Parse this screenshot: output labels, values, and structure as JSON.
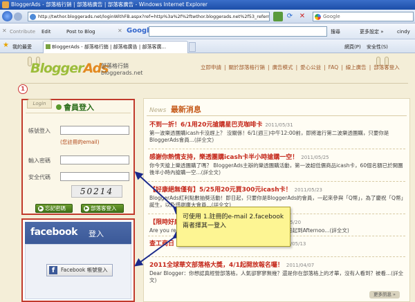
{
  "window": {
    "title": "BloggerAds - 部落格行銷 | 部落格廣告 | 部落客廣告 - Windows Internet Explorer",
    "url": "http://twthor.bloggerads.net/loginWithFB.aspx?ref=http%3a%2f%2ftwthor.bloggerads.net%2f53_referral_cod",
    "google_search_placeholder": "Google"
  },
  "toolbar": {
    "contribute": "Contribute",
    "edit": "Edit",
    "post_to_blog": "Post to Blog",
    "google": "Google",
    "search": "搜尋",
    "settings": "更多設定 »",
    "user": "cindy"
  },
  "favbar": {
    "favorites": "我的最愛",
    "tab_title": "BloggerAds - 部落格行銷 | 部落格廣告 | 部落客廣...",
    "page_menu": "網頁(P)",
    "safety_menu": "安全性(S)"
  },
  "site": {
    "logo_main": "Blogger",
    "logo_accent": "Ads",
    "logo_sub_cn": "部落格行銷",
    "logo_sub_en": "bloggerads.net",
    "nav": [
      "立即申請",
      "關於部落格行銷",
      "廣告模式",
      "愛心公益",
      "FAQ",
      "線上廣告",
      "部落客登入"
    ],
    "nav_sep": "|"
  },
  "step_badge": "1",
  "login": {
    "tab_label": "Login",
    "title": "會員登入",
    "account_label": "帳號登入",
    "account_hint": "(您註冊的email)",
    "password_label": "輸入密碼",
    "captcha_label": "安全代碼",
    "captcha_value": "50214",
    "forgot_button": "忘記密碼",
    "register_button": "部落客登入"
  },
  "facebook": {
    "brand": "facebook",
    "login_word": "登入",
    "button_label": "Facebook 帳號登入",
    "icon_letter": "f"
  },
  "news": {
    "header_en": "News",
    "header_cn": "最新消息",
    "items": [
      {
        "title": "不到一折！6/1用20元搶購星巴克咖啡卡",
        "date": "2011/05/31",
        "desc": "第一波樂透團購icash卡沒趕上？ 沒關係！6/1(週三)中午12:00前，即將進行第二波樂透團購，只要你是BloggerAds會員...",
        "more": "(詳全文)"
      },
      {
        "title": "感謝你熱情支持，樂透團購icash卡半小時搶購一空！",
        "date": "2011/05/25",
        "desc": "你今天搶上樂透團購了嗎？ BloggerAds主辦的樂透團購活動，第一波超低價商品icash卡，60個名額已於開團後半小時內搶購一空...",
        "more": "(詳全文)"
      },
      {
        "title": "【好康絕無僅有】5/25用20元買300元icash卡！",
        "date": "2011/05/23",
        "desc": "BloggerAds紅利點數抽獎活動！即日起，只要你是BloggerAds的會員，一起來參與「Q幣」，為了慶祝「Q幣」誕生，以及感謝廣大會員...",
        "more": "(詳全文)"
      },
      {
        "title": "【限時好康】抽獎送7-ELEVEN「下午茶」",
        "date": "2011/05/20",
        "desc": "Are you ready? 即日起，只要你是BloggerAds的會員，即日起到Afternoo...",
        "more": "(詳全文)"
      },
      {
        "title": "查工商日",
        "date": "2011/05/13",
        "desc": "",
        "more": ""
      },
      {
        "title": "2011全球華文部落格大獎，4/1起開放報名囉！",
        "date": "2011/04/07",
        "desc": "Dear Blogger：你想認真經營部落格，人氣卻寥寥無幾？還是你在部落格上的才華，沒有人看到？被看...",
        "more": "(詳全文)"
      }
    ],
    "more_button": "更多訊息 »"
  },
  "callout": {
    "line1": "可使用 1.註冊的e-mail 2.facebook",
    "line2": "兩者擇其一登入"
  }
}
